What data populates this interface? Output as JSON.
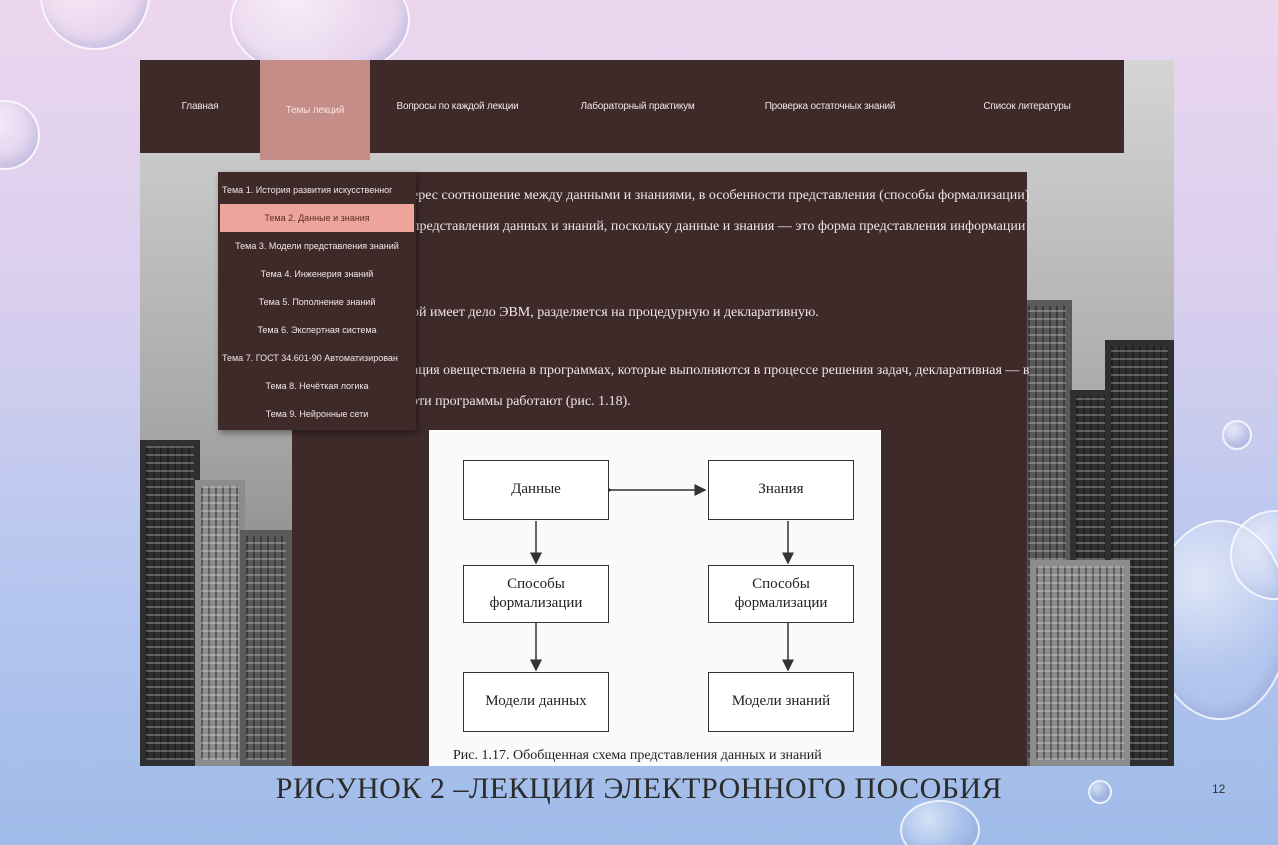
{
  "nav": {
    "items": [
      "Главная",
      "Темы лекций",
      "Вопросы по каждой лекции",
      "Лабораторный практикум",
      "Проверка остаточных знаний",
      "Список литературы"
    ],
    "active_index": 1
  },
  "dropdown": {
    "items": [
      "Тема 1. История развития искусственног",
      "Тема 2. Данные и знания",
      "Тема 3. Модели представления знаний",
      "Тема 4. Инженерия знаний",
      "Тема 5. Пополнение знаний",
      "Тема 6. Экспертная система",
      "Тема 7. ГОСТ 34.601-90 Автоматизирован",
      "Тема 8. Нечёткая логика",
      "Тема 9. Нейронные сети"
    ],
    "active_index": 1
  },
  "content": {
    "paragraphs": [
      "ерес соотношение между данными и знаниями, в особенности представления (способы формализации)",
      "представления данных и знаний, поскольку данные и знания — это форма представления информации",
      "ой имеет дело ЭВМ, разделяется на процедурную и декларативную.",
      "ация овеществлена в программах, которые выполняются в процессе решения задач, декларативная — в",
      "эти программы работают (рис. 1.18)."
    ]
  },
  "figure": {
    "boxes": {
      "data": "Данные",
      "knowledge": "Знания",
      "formalization_left": "Способы формализации",
      "formalization_right": "Способы формализации",
      "data_models": "Модели данных",
      "knowledge_models": "Модели знаний"
    },
    "caption": "Рис. 1.17. Обобщенная схема представления данных и знаний"
  },
  "slide": {
    "title": "РИСУНОК 2 –ЛЕКЦИИ ЭЛЕКТРОННОГО ПОСОБИЯ",
    "page_number": "12"
  },
  "colors": {
    "panel": "#3e2b29",
    "nav_active": "#c58d87",
    "menu_active": "#eda49b"
  }
}
